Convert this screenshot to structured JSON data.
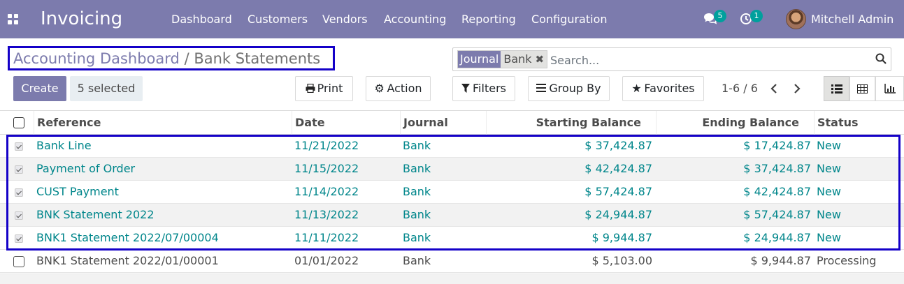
{
  "navbar": {
    "app_name": "Invoicing",
    "menu": [
      "Dashboard",
      "Customers",
      "Vendors",
      "Accounting",
      "Reporting",
      "Configuration"
    ],
    "messages_count": "5",
    "activities_count": "1",
    "user_name": "Mitchell Admin"
  },
  "breadcrumb": {
    "parent": "Accounting Dashboard",
    "separator": "/",
    "current": "Bank Statements"
  },
  "search": {
    "facet_label": "Journal",
    "facet_value": "Bank",
    "placeholder": "Search..."
  },
  "buttons": {
    "create": "Create",
    "selected": "5 selected",
    "print": "Print",
    "action": "Action",
    "filters": "Filters",
    "group_by": "Group By",
    "favorites": "Favorites"
  },
  "pager": {
    "value": "1-6 / 6"
  },
  "table": {
    "columns": [
      "Reference",
      "Date",
      "Journal",
      "Starting Balance",
      "Ending Balance",
      "Status"
    ],
    "rows": [
      {
        "reference": "Bank Line",
        "date": "11/21/2022",
        "journal": "Bank",
        "start": "$ 37,424.87",
        "end": "$ 17,424.87",
        "status": "New",
        "selected": true
      },
      {
        "reference": "Payment of Order",
        "date": "11/15/2022",
        "journal": "Bank",
        "start": "$ 42,424.87",
        "end": "$ 37,424.87",
        "status": "New",
        "selected": true
      },
      {
        "reference": "CUST Payment",
        "date": "11/14/2022",
        "journal": "Bank",
        "start": "$ 57,424.87",
        "end": "$ 42,424.87",
        "status": "New",
        "selected": true
      },
      {
        "reference": "BNK Statement 2022",
        "date": "11/13/2022",
        "journal": "Bank",
        "start": "$ 24,944.87",
        "end": "$ 57,424.87",
        "status": "New",
        "selected": true
      },
      {
        "reference": "BNK1 Statement 2022/07/00004",
        "date": "11/11/2022",
        "journal": "Bank",
        "start": "$ 9,944.87",
        "end": "$ 24,944.87",
        "status": "New",
        "selected": true
      },
      {
        "reference": "BNK1 Statement 2022/01/00001",
        "date": "01/01/2022",
        "journal": "Bank",
        "start": "$ 5,103.00",
        "end": "$ 9,944.87",
        "status": "Processing",
        "selected": false
      }
    ]
  },
  "colors": {
    "navbar": "#7c7bad",
    "accent_teal": "#00a09d",
    "link_teal": "#00868b",
    "highlight_outline": "#1400c8"
  }
}
